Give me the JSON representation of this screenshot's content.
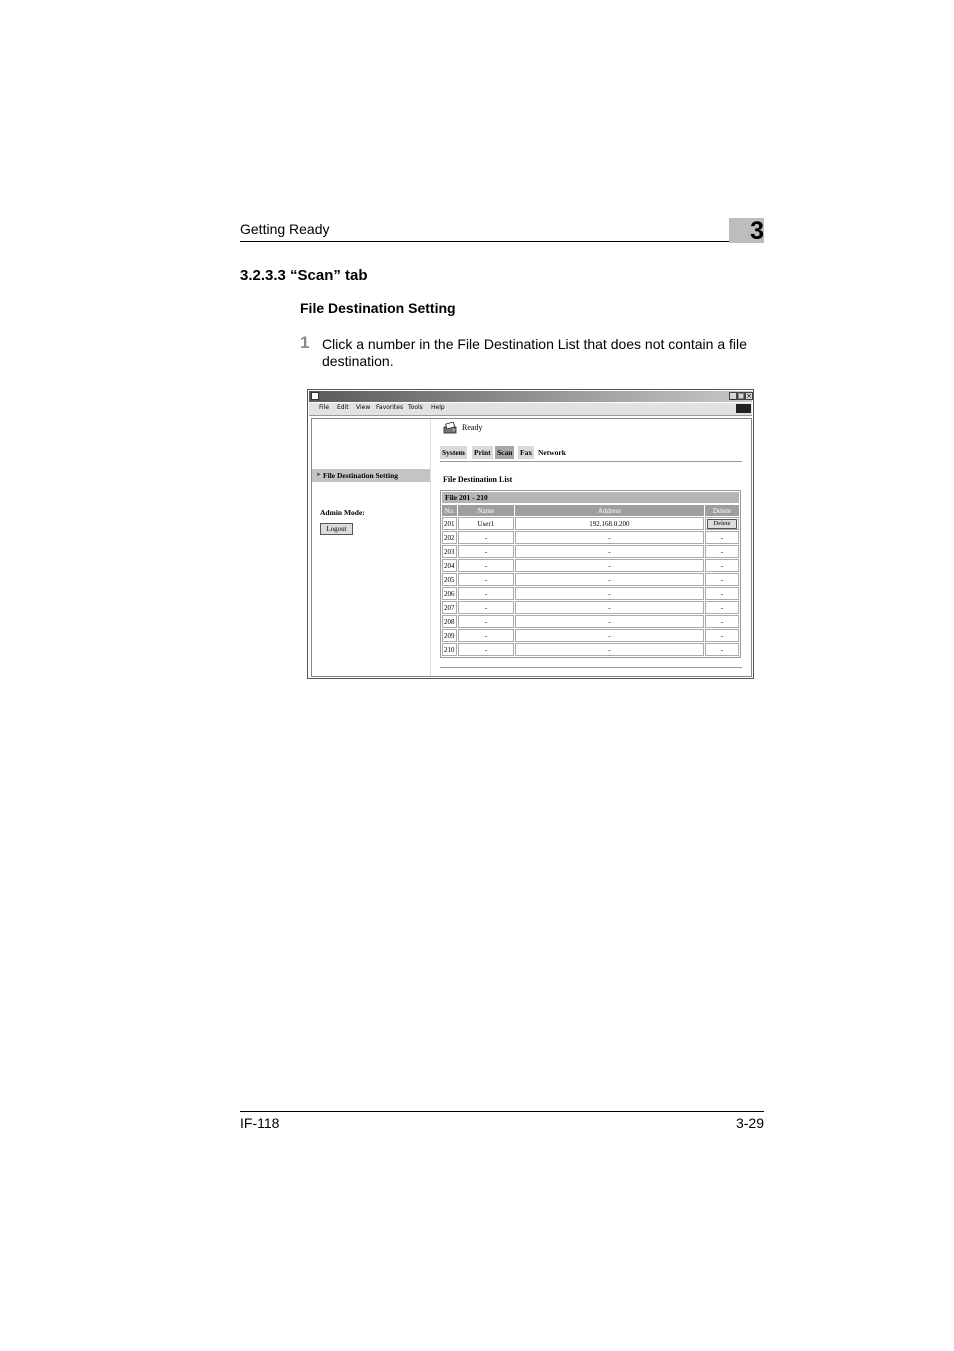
{
  "header": {
    "title": "Getting Ready",
    "chapter": "3"
  },
  "section": {
    "number_title": "3.2.3.3  “Scan” tab"
  },
  "subsection": {
    "title": "File Destination Setting"
  },
  "step": {
    "number": "1",
    "text": "Click a number in the File Destination List that does not contain a file destination."
  },
  "window": {
    "menu": [
      "File",
      "Edit",
      "View",
      "Favorites",
      "Tools",
      "Help"
    ],
    "controls": [
      "_",
      "□",
      "×"
    ],
    "status": "Ready",
    "tabs": [
      {
        "label": "System",
        "active": false
      },
      {
        "label": "Print",
        "active": false
      },
      {
        "label": "Scan",
        "active": true
      },
      {
        "label": "Fax",
        "active": false
      },
      {
        "label": "Network",
        "active": false
      }
    ],
    "sidebar": {
      "nav_item": "File Destination Setting",
      "admin_label": "Admin Mode:",
      "logout": "Logout"
    },
    "list": {
      "title": "File Destination List",
      "caption": "File 201 - 210",
      "columns": [
        "No.",
        "Name",
        "Address",
        "Delete"
      ],
      "rows": [
        {
          "no": "201",
          "name": "User1",
          "address": "192.168.0.200",
          "delete": "Delete"
        },
        {
          "no": "202",
          "name": "-",
          "address": "-",
          "delete": "-"
        },
        {
          "no": "203",
          "name": "-",
          "address": "-",
          "delete": "-"
        },
        {
          "no": "204",
          "name": "-",
          "address": "-",
          "delete": "-"
        },
        {
          "no": "205",
          "name": "-",
          "address": "-",
          "delete": "-"
        },
        {
          "no": "206",
          "name": "-",
          "address": "-",
          "delete": "-"
        },
        {
          "no": "207",
          "name": "-",
          "address": "-",
          "delete": "-"
        },
        {
          "no": "208",
          "name": "-",
          "address": "-",
          "delete": "-"
        },
        {
          "no": "209",
          "name": "-",
          "address": "-",
          "delete": "-"
        },
        {
          "no": "210",
          "name": "-",
          "address": "-",
          "delete": "-"
        }
      ]
    }
  },
  "footer": {
    "left": "IF-118",
    "right": "3-29"
  }
}
